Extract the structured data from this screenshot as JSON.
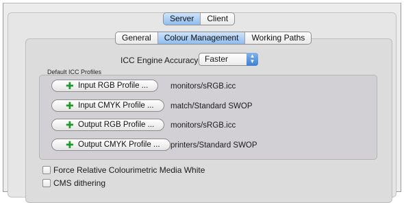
{
  "top_tabs": [
    {
      "label": "Server",
      "active": true
    },
    {
      "label": "Client",
      "active": false
    }
  ],
  "sub_tabs": [
    {
      "label": "General",
      "active": false
    },
    {
      "label": "Colour Management",
      "active": true
    },
    {
      "label": "Working Paths",
      "active": false
    }
  ],
  "icc_engine": {
    "label": "ICC Engine Accuracy:",
    "selected": "Faster"
  },
  "default_profiles": {
    "group_label": "Default ICC Profiles",
    "rows": [
      {
        "button": "Input RGB Profile ...",
        "value": "monitors/sRGB.icc"
      },
      {
        "button": "Input CMYK Profile ...",
        "value": "match/Standard SWOP"
      },
      {
        "button": "Output RGB Profile ...",
        "value": "monitors/sRGB.icc"
      },
      {
        "button": "Output CMYK Profile ...",
        "value": "printers/Standard SWOP"
      }
    ]
  },
  "options": [
    {
      "label": "Force Relative Colourimetric Media White",
      "checked": false
    },
    {
      "label": "CMS dithering",
      "checked": false
    }
  ],
  "colors": {
    "active_tab": "#8fbcee",
    "plus_icon": "#1e9a2a",
    "popup_stepper": "#3f7fd2"
  }
}
